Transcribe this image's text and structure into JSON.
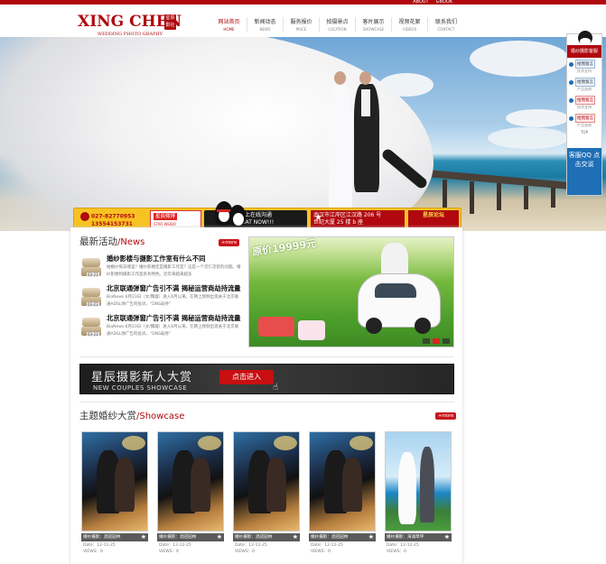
{
  "top": {
    "links": [
      "ABOUT",
      "GBOOK"
    ]
  },
  "logo": {
    "name": "XING CHEN",
    "subtitle": "WEDDING PHOTO GRAPHY",
    "seal": "星辰影社"
  },
  "nav": [
    {
      "cn": "网站首页",
      "en": "HOME",
      "active": true
    },
    {
      "cn": "新闻动态",
      "en": "NEWS"
    },
    {
      "cn": "服务报价",
      "en": "PRICE"
    },
    {
      "cn": "拍摄景点",
      "en": "LOCATION"
    },
    {
      "cn": "客片展示",
      "en": "SHOWCASE"
    },
    {
      "cn": "视频花絮",
      "en": "VIDEOS"
    },
    {
      "cn": "联系我们",
      "en": "CONTACT"
    }
  ],
  "sidebar": {
    "header": "婚纱摄影客服",
    "items": [
      {
        "label": "给我留言",
        "cap": "技术支持",
        "style": "blue"
      },
      {
        "label": "给我留言",
        "cap": "产品咨询",
        "style": "blue"
      },
      {
        "label": "给我留言",
        "cap": "技术支持",
        "style": "red"
      },
      {
        "label": "给我留言",
        "cap": "产品咨询",
        "style": "red"
      }
    ],
    "top": "TOP",
    "bottom": "客服QQ 点击交谈"
  },
  "infobar": {
    "phone1": "027-82770953",
    "phone2": "13554153731",
    "weibo_cn": "星辰微博",
    "weibo_en": "STAR WEIBO",
    "chat_cn": "马上在线沟通",
    "chat_en": "CHAT NOW!!!",
    "addr1": "武汉市江岸区江汉路 206 号",
    "addr2": "世纪大厦 25 楼 b 座",
    "forum": "星辰论坛"
  },
  "news": {
    "title_cn": "最新活动",
    "title_en": "/News",
    "more": "+more",
    "items": [
      {
        "title": "婚纱影楼与摄影工作室有什么不同",
        "desc": "拍婚纱照去哪里？婚纱影楼还是摄影工作室？这是一个见仁见智的问题。婚纱影楼和摄影工作室各有特色。近年来越来越多",
        "tag": "03-23"
      },
      {
        "title": "北京联通弹窗广告引不满 揭秘运营商劫持流量",
        "desc": "BiaNews 6月23日（文/魏璇）进入6月以来，在网上频频出现关于北京联通ADSL弹广告的投诉，“DNS劫持”",
        "tag": "03-23"
      },
      {
        "title": "北京联通弹窗广告引不满 揭秘运营商劫持流量",
        "desc": "BiaNews 6月23日（文/魏璇）进入6月以来，在网上频频出现关于北京联通ADSL弹广告的投诉，“DNS劫持”",
        "tag": "03-23"
      }
    ]
  },
  "feature": {
    "promo": "原价19999元"
  },
  "ad": {
    "cn": "星辰摄影新人大赏",
    "en": "NEW COUPLES SHOWCASE",
    "button": "点击进入"
  },
  "showcase": {
    "title_cn": "主题婚纱大赏",
    "title_en": "/Showcase",
    "more": "+more",
    "items": [
      {
        "label": "婚纱摄影：酒店园林",
        "date": "Date：12-12-25",
        "views": "VIEWS：0"
      },
      {
        "label": "婚纱摄影：酒店园林",
        "date": "Date：12-12-25",
        "views": "VIEWS：0"
      },
      {
        "label": "婚纱摄影：酒店园林",
        "date": "Date：12-12-25",
        "views": "VIEWS：0"
      },
      {
        "label": "婚纱摄影：酒店园林",
        "date": "Date：12-12-25",
        "views": "VIEWS：0"
      },
      {
        "label": "婚纱摄影：海滩草坪",
        "date": "Date：12-12-25",
        "views": "VIEWS：0"
      }
    ]
  },
  "colors": {
    "brand": "#b0080e",
    "accent": "#f7c322"
  },
  "icons": [
    "phone-icon",
    "weibo-icon",
    "qq-penguin-icon",
    "star-icon",
    "trophy-icon",
    "favorite-star-icon",
    "cursor-icon"
  ]
}
